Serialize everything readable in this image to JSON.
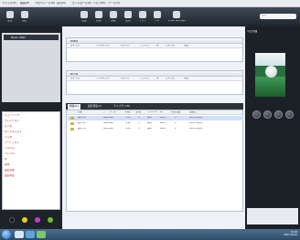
{
  "menubar": {
    "items": [
      "ファイル(F)",
      "編集(E)",
      "プロフィール(P)",
      "表示(V)",
      "コントロール(C)",
      "ヘルプ(H)",
      "ツール(T)"
    ]
  },
  "toolbar": {
    "buttons": [
      "戻る",
      "進む",
      "追加",
      "削除",
      "情報",
      "更新",
      "リスト",
      "CD",
      "Video Settings"
    ]
  },
  "search": {
    "placeholder": "検索"
  },
  "sidebar": {
    "header": "Music 2003",
    "items": [
      "ミュージック",
      "プレイリスト",
      "ビデオ",
      "ポッドキャスト",
      "ラジオ",
      "アーティスト",
      "アルバム",
      "ジャンル",
      "年",
      "評価",
      "最近追加",
      "最近再生"
    ]
  },
  "upper_panel": {
    "title": "特価順",
    "columns": [
      "タイトル",
      "アーティスト",
      "アルバム",
      "トラック",
      "年",
      "ジャンル",
      "時間"
    ]
  },
  "middle_panel": {
    "title": "販売順",
    "columns": [
      "タイトル",
      "アーティスト",
      "アルバム",
      "トラック",
      "年",
      "ジャンル",
      "時間"
    ]
  },
  "tabs": [
    "特集(A)",
    "最近再生(C)",
    "ライブラリ(B)"
  ],
  "table": {
    "columns": [
      "名前",
      "アーティスト",
      "時間",
      "評価",
      "ジャンル",
      "年",
      "再生回数",
      "追加日"
    ],
    "rows": [
      [
        "Jazz 01",
        "unknown",
        "3:28",
        "4",
        "Jazz",
        "2003",
        "0",
        "2007/10/01"
      ],
      [
        "Jazz 02",
        "unknown",
        "4:12",
        "3",
        "Jazz",
        "2003",
        "0",
        "2007/10/01"
      ],
      [
        "Jazz 03",
        "unknown",
        "5:01",
        "3",
        "Jazz",
        "2003",
        "0",
        "2007/10/01"
      ]
    ]
  },
  "right_panel": {
    "title": "今日の曲"
  },
  "taskbar": {
    "time": "10:28",
    "date": "2007/10/01"
  },
  "colors": {
    "toolbar_dark": "#2a323b",
    "panel_border": "#b8c2cf",
    "selection_blue": "#cfe0f7",
    "accent_red": "#a11111"
  }
}
